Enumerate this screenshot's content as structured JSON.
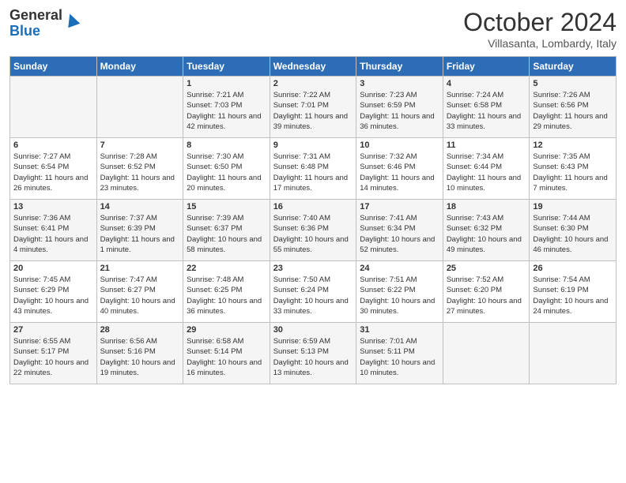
{
  "header": {
    "logo_general": "General",
    "logo_blue": "Blue",
    "month_title": "October 2024",
    "location": "Villasanta, Lombardy, Italy"
  },
  "days_of_week": [
    "Sunday",
    "Monday",
    "Tuesday",
    "Wednesday",
    "Thursday",
    "Friday",
    "Saturday"
  ],
  "weeks": [
    [
      {
        "day": "",
        "detail": ""
      },
      {
        "day": "",
        "detail": ""
      },
      {
        "day": "1",
        "detail": "Sunrise: 7:21 AM\nSunset: 7:03 PM\nDaylight: 11 hours and 42 minutes."
      },
      {
        "day": "2",
        "detail": "Sunrise: 7:22 AM\nSunset: 7:01 PM\nDaylight: 11 hours and 39 minutes."
      },
      {
        "day": "3",
        "detail": "Sunrise: 7:23 AM\nSunset: 6:59 PM\nDaylight: 11 hours and 36 minutes."
      },
      {
        "day": "4",
        "detail": "Sunrise: 7:24 AM\nSunset: 6:58 PM\nDaylight: 11 hours and 33 minutes."
      },
      {
        "day": "5",
        "detail": "Sunrise: 7:26 AM\nSunset: 6:56 PM\nDaylight: 11 hours and 29 minutes."
      }
    ],
    [
      {
        "day": "6",
        "detail": "Sunrise: 7:27 AM\nSunset: 6:54 PM\nDaylight: 11 hours and 26 minutes."
      },
      {
        "day": "7",
        "detail": "Sunrise: 7:28 AM\nSunset: 6:52 PM\nDaylight: 11 hours and 23 minutes."
      },
      {
        "day": "8",
        "detail": "Sunrise: 7:30 AM\nSunset: 6:50 PM\nDaylight: 11 hours and 20 minutes."
      },
      {
        "day": "9",
        "detail": "Sunrise: 7:31 AM\nSunset: 6:48 PM\nDaylight: 11 hours and 17 minutes."
      },
      {
        "day": "10",
        "detail": "Sunrise: 7:32 AM\nSunset: 6:46 PM\nDaylight: 11 hours and 14 minutes."
      },
      {
        "day": "11",
        "detail": "Sunrise: 7:34 AM\nSunset: 6:44 PM\nDaylight: 11 hours and 10 minutes."
      },
      {
        "day": "12",
        "detail": "Sunrise: 7:35 AM\nSunset: 6:43 PM\nDaylight: 11 hours and 7 minutes."
      }
    ],
    [
      {
        "day": "13",
        "detail": "Sunrise: 7:36 AM\nSunset: 6:41 PM\nDaylight: 11 hours and 4 minutes."
      },
      {
        "day": "14",
        "detail": "Sunrise: 7:37 AM\nSunset: 6:39 PM\nDaylight: 11 hours and 1 minute."
      },
      {
        "day": "15",
        "detail": "Sunrise: 7:39 AM\nSunset: 6:37 PM\nDaylight: 10 hours and 58 minutes."
      },
      {
        "day": "16",
        "detail": "Sunrise: 7:40 AM\nSunset: 6:36 PM\nDaylight: 10 hours and 55 minutes."
      },
      {
        "day": "17",
        "detail": "Sunrise: 7:41 AM\nSunset: 6:34 PM\nDaylight: 10 hours and 52 minutes."
      },
      {
        "day": "18",
        "detail": "Sunrise: 7:43 AM\nSunset: 6:32 PM\nDaylight: 10 hours and 49 minutes."
      },
      {
        "day": "19",
        "detail": "Sunrise: 7:44 AM\nSunset: 6:30 PM\nDaylight: 10 hours and 46 minutes."
      }
    ],
    [
      {
        "day": "20",
        "detail": "Sunrise: 7:45 AM\nSunset: 6:29 PM\nDaylight: 10 hours and 43 minutes."
      },
      {
        "day": "21",
        "detail": "Sunrise: 7:47 AM\nSunset: 6:27 PM\nDaylight: 10 hours and 40 minutes."
      },
      {
        "day": "22",
        "detail": "Sunrise: 7:48 AM\nSunset: 6:25 PM\nDaylight: 10 hours and 36 minutes."
      },
      {
        "day": "23",
        "detail": "Sunrise: 7:50 AM\nSunset: 6:24 PM\nDaylight: 10 hours and 33 minutes."
      },
      {
        "day": "24",
        "detail": "Sunrise: 7:51 AM\nSunset: 6:22 PM\nDaylight: 10 hours and 30 minutes."
      },
      {
        "day": "25",
        "detail": "Sunrise: 7:52 AM\nSunset: 6:20 PM\nDaylight: 10 hours and 27 minutes."
      },
      {
        "day": "26",
        "detail": "Sunrise: 7:54 AM\nSunset: 6:19 PM\nDaylight: 10 hours and 24 minutes."
      }
    ],
    [
      {
        "day": "27",
        "detail": "Sunrise: 6:55 AM\nSunset: 5:17 PM\nDaylight: 10 hours and 22 minutes."
      },
      {
        "day": "28",
        "detail": "Sunrise: 6:56 AM\nSunset: 5:16 PM\nDaylight: 10 hours and 19 minutes."
      },
      {
        "day": "29",
        "detail": "Sunrise: 6:58 AM\nSunset: 5:14 PM\nDaylight: 10 hours and 16 minutes."
      },
      {
        "day": "30",
        "detail": "Sunrise: 6:59 AM\nSunset: 5:13 PM\nDaylight: 10 hours and 13 minutes."
      },
      {
        "day": "31",
        "detail": "Sunrise: 7:01 AM\nSunset: 5:11 PM\nDaylight: 10 hours and 10 minutes."
      },
      {
        "day": "",
        "detail": ""
      },
      {
        "day": "",
        "detail": ""
      }
    ]
  ]
}
